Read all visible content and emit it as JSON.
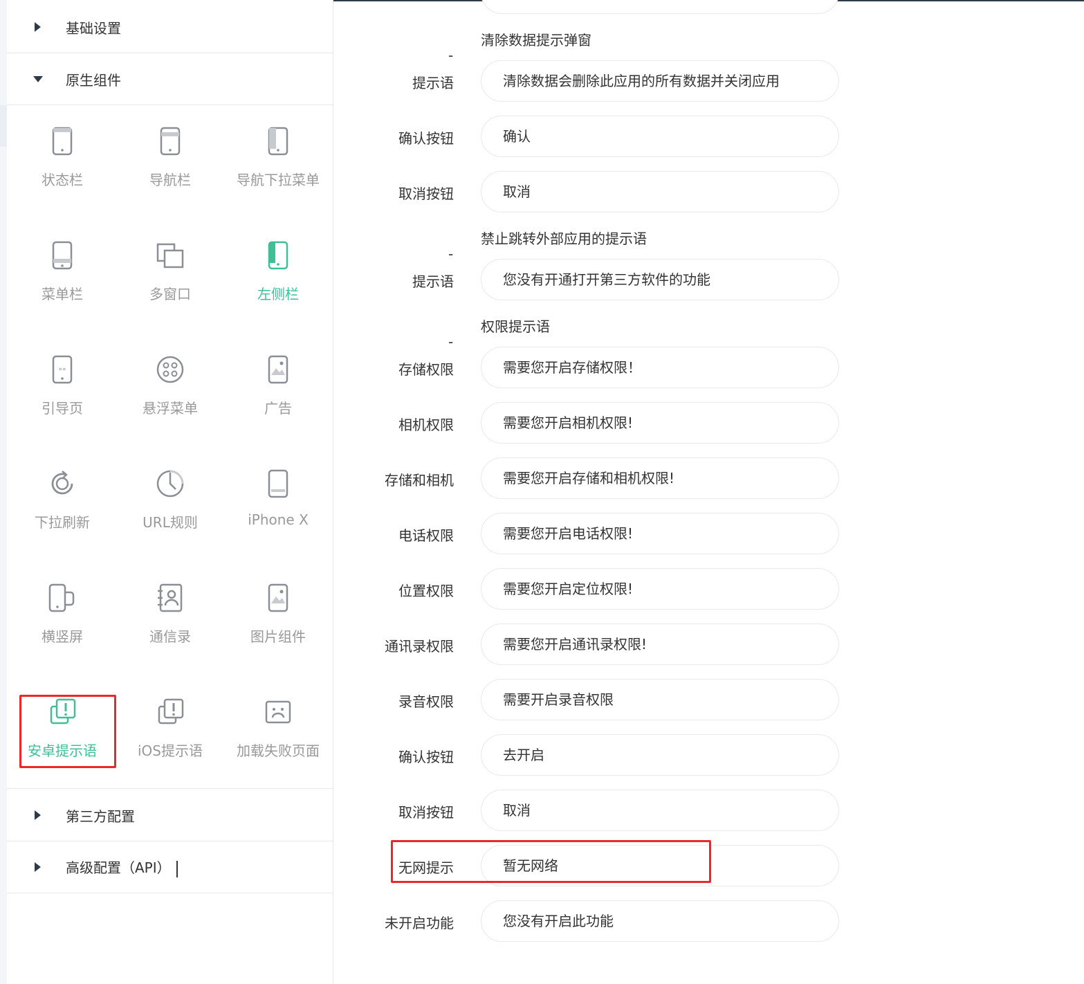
{
  "sidebar": {
    "sections_top": [
      {
        "label": "基础设置",
        "state": "collapsed"
      },
      {
        "label": "原生组件",
        "state": "expanded"
      }
    ],
    "components": [
      {
        "label": "状态栏",
        "icon": "status-bar-icon",
        "active": false
      },
      {
        "label": "导航栏",
        "icon": "nav-bar-icon",
        "active": false
      },
      {
        "label": "导航下拉菜单",
        "icon": "nav-dropdown-icon",
        "active": false
      },
      {
        "label": "菜单栏",
        "icon": "menu-bar-icon",
        "active": false
      },
      {
        "label": "多窗口",
        "icon": "multi-window-icon",
        "active": false
      },
      {
        "label": "左侧栏",
        "icon": "left-sidebar-icon",
        "active": true
      },
      {
        "label": "引导页",
        "icon": "guide-page-icon",
        "active": false
      },
      {
        "label": "悬浮菜单",
        "icon": "float-menu-icon",
        "active": false
      },
      {
        "label": "广告",
        "icon": "ad-icon",
        "active": false
      },
      {
        "label": "下拉刷新",
        "icon": "pull-refresh-icon",
        "active": false
      },
      {
        "label": "URL规则",
        "icon": "url-rule-icon",
        "active": false
      },
      {
        "label": "iPhone X",
        "icon": "iphone-x-icon",
        "active": false
      },
      {
        "label": "横竖屏",
        "icon": "orientation-icon",
        "active": false
      },
      {
        "label": "通信录",
        "icon": "contacts-icon",
        "active": false
      },
      {
        "label": "图片组件",
        "icon": "image-component-icon",
        "active": false
      },
      {
        "label": "安卓提示语",
        "icon": "android-tip-icon",
        "active": true
      },
      {
        "label": "iOS提示语",
        "icon": "ios-tip-icon",
        "active": false
      },
      {
        "label": "加载失败页面",
        "icon": "load-fail-icon",
        "active": false
      }
    ],
    "sections_bottom": [
      {
        "label": "第三方配置",
        "state": "collapsed"
      },
      {
        "label": "高级配置（API）",
        "state": "collapsed"
      }
    ]
  },
  "form": {
    "group_clear": {
      "dash": "-",
      "title": "清除数据提示弹窗"
    },
    "clear_tip": {
      "label": "提示语",
      "value": "清除数据会删除此应用的所有数据并关闭应用"
    },
    "clear_confirm": {
      "label": "确认按钮",
      "value": "确认"
    },
    "clear_cancel": {
      "label": "取消按钮",
      "value": "取消"
    },
    "group_external": {
      "dash": "-",
      "title": "禁止跳转外部应用的提示语"
    },
    "external_tip": {
      "label": "提示语",
      "value": "您没有开通打开第三方软件的功能"
    },
    "group_permission": {
      "dash": "-",
      "title": "权限提示语"
    },
    "perm_storage": {
      "label": "存储权限",
      "value": "需要您开启存储权限！"
    },
    "perm_camera": {
      "label": "相机权限",
      "value": "需要您开启相机权限!"
    },
    "perm_storage_camera": {
      "label": "存储和相机",
      "value": "需要您开启存储和相机权限!"
    },
    "perm_phone": {
      "label": "电话权限",
      "value": "需要您开启电话权限!"
    },
    "perm_location": {
      "label": "位置权限",
      "value": "需要您开启定位权限!"
    },
    "perm_contacts": {
      "label": "通讯录权限",
      "value": "需要您开启通讯录权限!"
    },
    "perm_audio": {
      "label": "录音权限",
      "value": "需要开启录音权限"
    },
    "perm_confirm": {
      "label": "确认按钮",
      "value": "去开启"
    },
    "perm_cancel": {
      "label": "取消按钮",
      "value": "取消"
    },
    "no_network": {
      "label": "无网提示",
      "value": "暂无网络"
    },
    "not_enabled": {
      "label": "未开启功能",
      "value": "您没有开启此功能"
    }
  },
  "colors": {
    "accent": "#3fbf95",
    "highlight": "#e8282b",
    "icon_gray": "#8a8f96"
  }
}
